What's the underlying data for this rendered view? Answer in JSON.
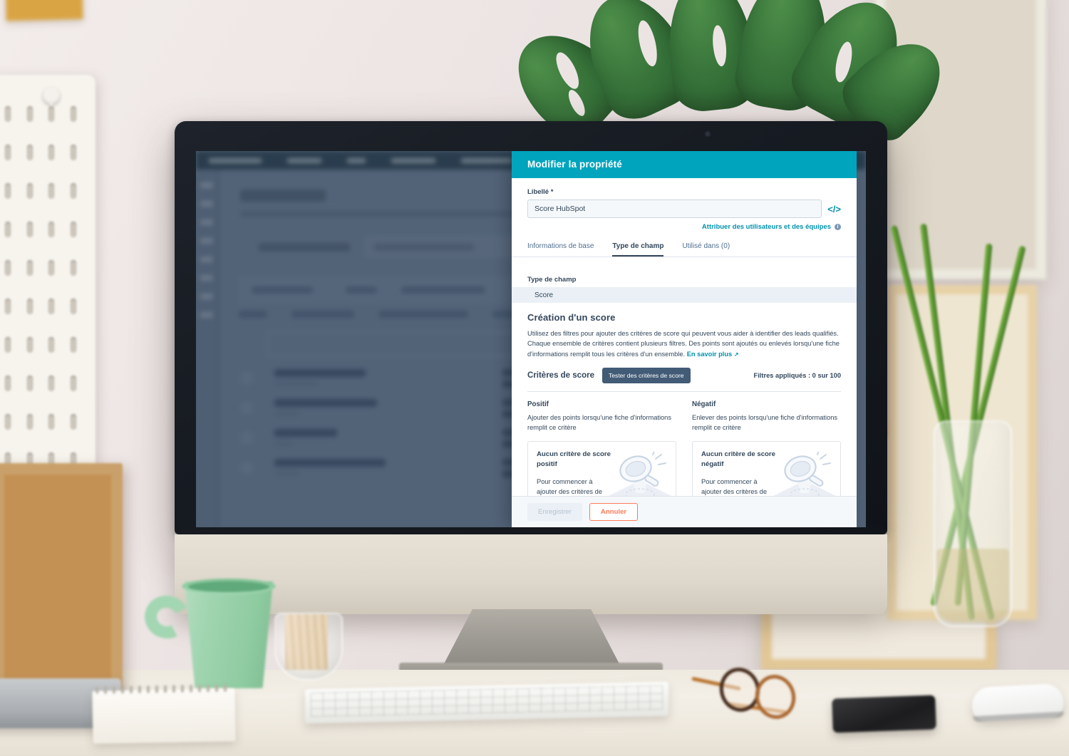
{
  "modal": {
    "title": "Modifier la propriété",
    "label_field": {
      "label": "Libellé *",
      "value": "Score HubSpot",
      "code_icon": "</>"
    },
    "assign": {
      "link": "Attribuer des utilisateurs et des équipes",
      "info_icon": "i"
    },
    "tabs": [
      {
        "label": "Informations de base",
        "active": false
      },
      {
        "label": "Type de champ",
        "active": true
      },
      {
        "label": "Utilisé dans (0)",
        "active": false
      }
    ],
    "field_type": {
      "label": "Type de champ",
      "value": "Score"
    },
    "score_section": {
      "heading": "Création d'un score",
      "description": "Utilisez des filtres pour ajouter des critères de score qui peuvent vous aider à identifier des leads qualifiés. Chaque ensemble de critères contient plusieurs filtres. Des points sont ajoutés ou enlevés lorsqu'une fiche d'informations remplit tous les critères d'un ensemble.",
      "learn_more": "En savoir plus",
      "criteria_title": "Critères de score",
      "test_button": "Tester des critères de score",
      "filters_applied": "Filtres appliqués : 0 sur 100"
    },
    "columns": [
      {
        "heading": "Positif",
        "description": "Ajouter des points lorsqu'une fiche d'informations remplit ce critère",
        "empty_title": "Aucun critère de score positif",
        "empty_body": "Pour commencer à ajouter des critères de score positifs, cliquez sur"
      },
      {
        "heading": "Négatif",
        "description": "Enlever des points lorsqu'une fiche d'informations remplit ce critère",
        "empty_title": "Aucun critère de score négatif",
        "empty_body": "Pour commencer à ajouter des critères de score négatifs, cliquez sur"
      }
    ],
    "footer": {
      "save": "Enregistrer",
      "cancel": "Annuler"
    }
  },
  "colors": {
    "header_teal": "#00a4bd",
    "link_teal": "#0091ae",
    "text_navy": "#33475b",
    "button_dark": "#425b76",
    "cancel_orange": "#ff7a59"
  },
  "scene": {
    "device": "imac-desktop-monitor",
    "objects": [
      "pegboard",
      "sticky-note",
      "picture-frame",
      "monstera-plant",
      "coffee-mug",
      "spiral-notebook",
      "glass-jar",
      "keyboard",
      "eyeglasses",
      "smartphone",
      "mouse",
      "glass-vase",
      "laptop"
    ]
  }
}
